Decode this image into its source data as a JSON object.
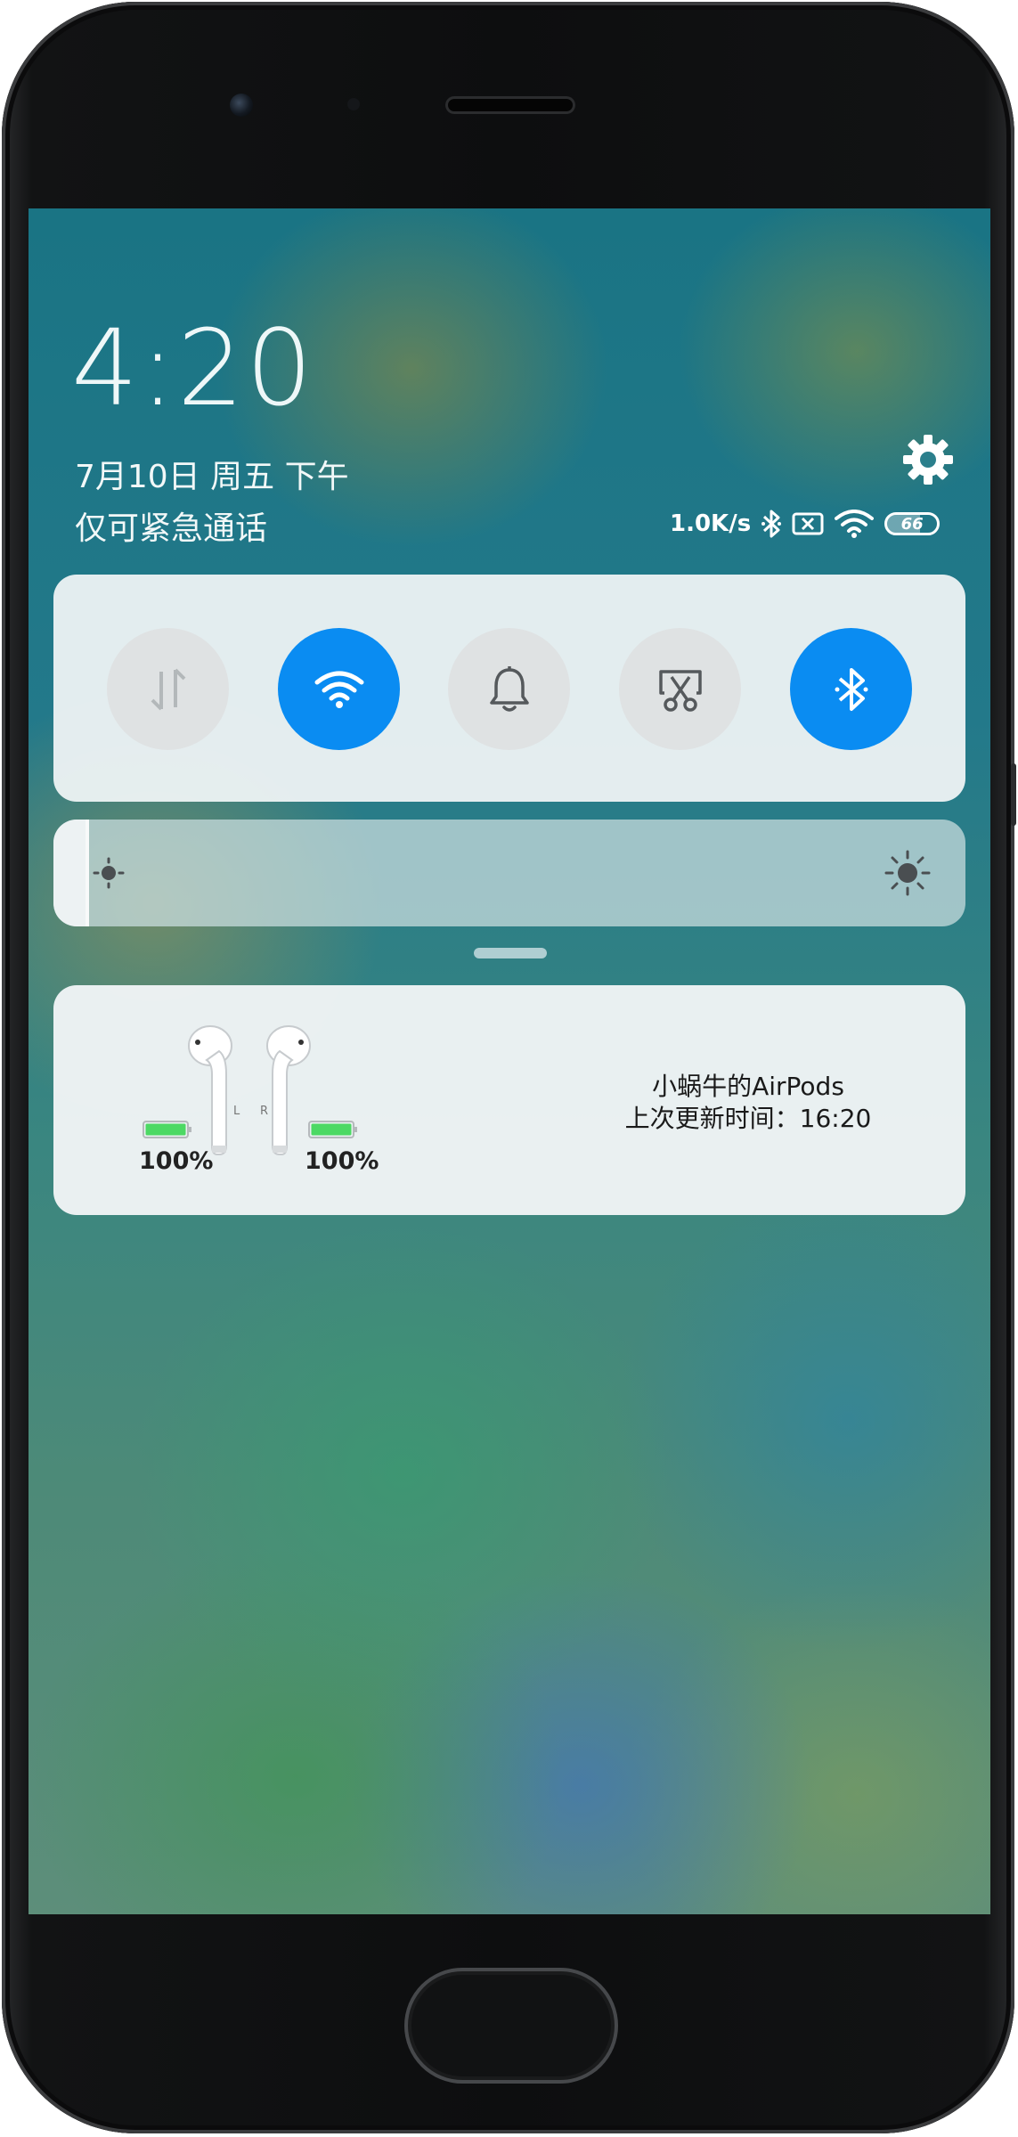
{
  "lockscreen": {
    "time": "4:20",
    "date": "7月10日 周五 下午",
    "carrier_status": "仅可紧急通话"
  },
  "status_bar": {
    "network_speed": "1.0K/s",
    "icons": [
      "bluetooth-icon",
      "no-sim-icon",
      "wifi-icon"
    ],
    "battery_level": "66"
  },
  "quick_toggles": [
    {
      "name": "mobile-data",
      "icon": "mobile-data-icon",
      "state": "off"
    },
    {
      "name": "wifi",
      "icon": "wifi-icon",
      "state": "on"
    },
    {
      "name": "ringer",
      "icon": "bell-icon",
      "state": "off"
    },
    {
      "name": "screenshot",
      "icon": "scissors-icon",
      "state": "off"
    },
    {
      "name": "bluetooth",
      "icon": "bluetooth-icon",
      "state": "on"
    }
  ],
  "brightness": {
    "level_fraction": 0.035,
    "min_icon": "brightness-low-icon",
    "max_icon": "brightness-high-icon"
  },
  "airpods": {
    "left_battery": "100%",
    "right_battery": "100%",
    "left_letter": "L",
    "right_letter": "R",
    "device_name": "小蜗牛的AirPods",
    "last_updated": "上次更新时间：16:20"
  },
  "colors": {
    "accent": "#0a8cf2",
    "battery_green": "#4cd964",
    "toggle_off": "#dfe2e3"
  }
}
